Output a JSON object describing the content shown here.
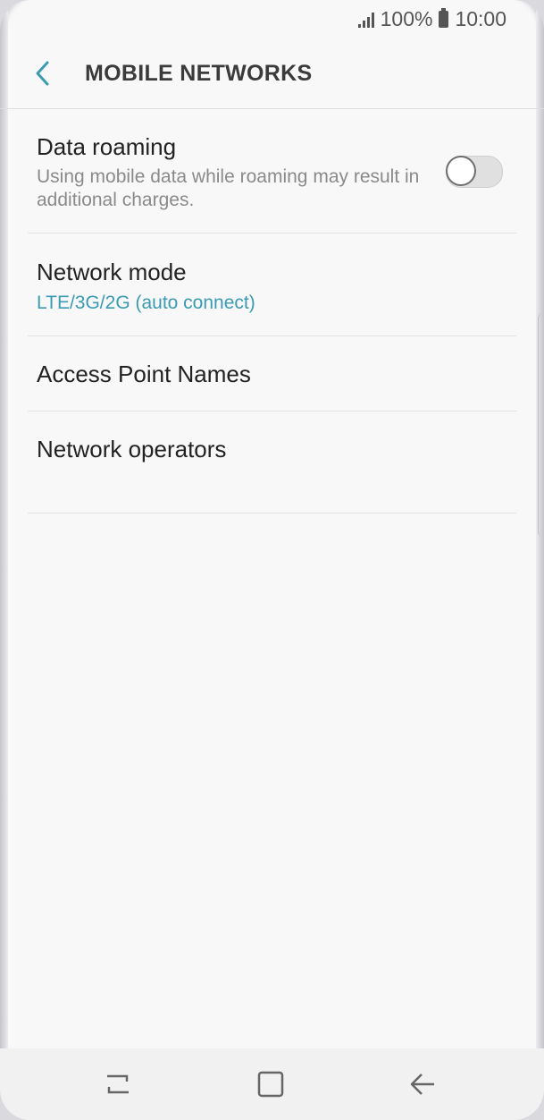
{
  "status_bar": {
    "battery": "100%",
    "time": "10:00",
    "icons": [
      "signal-icon",
      "battery-icon"
    ]
  },
  "header": {
    "title": "MOBILE NETWORKS",
    "back_icon": "chevron-left-icon"
  },
  "settings": [
    {
      "title": "Data roaming",
      "subtitle": "Using mobile data while roaming may result in additional charges.",
      "toggle_on": false
    },
    {
      "title": "Network mode",
      "subtitle": "LTE/3G/2G (auto connect)"
    },
    {
      "title": "Access Point Names"
    },
    {
      "title": "Network operators"
    }
  ],
  "nav_bar": {
    "icons": [
      "recent-apps-icon",
      "home-icon",
      "back-icon"
    ]
  },
  "colors": {
    "accent": "#3a9bb3",
    "background": "#f8f8f8",
    "title_text": "#3b3b3b",
    "secondary_text": "#8a8a8a"
  }
}
